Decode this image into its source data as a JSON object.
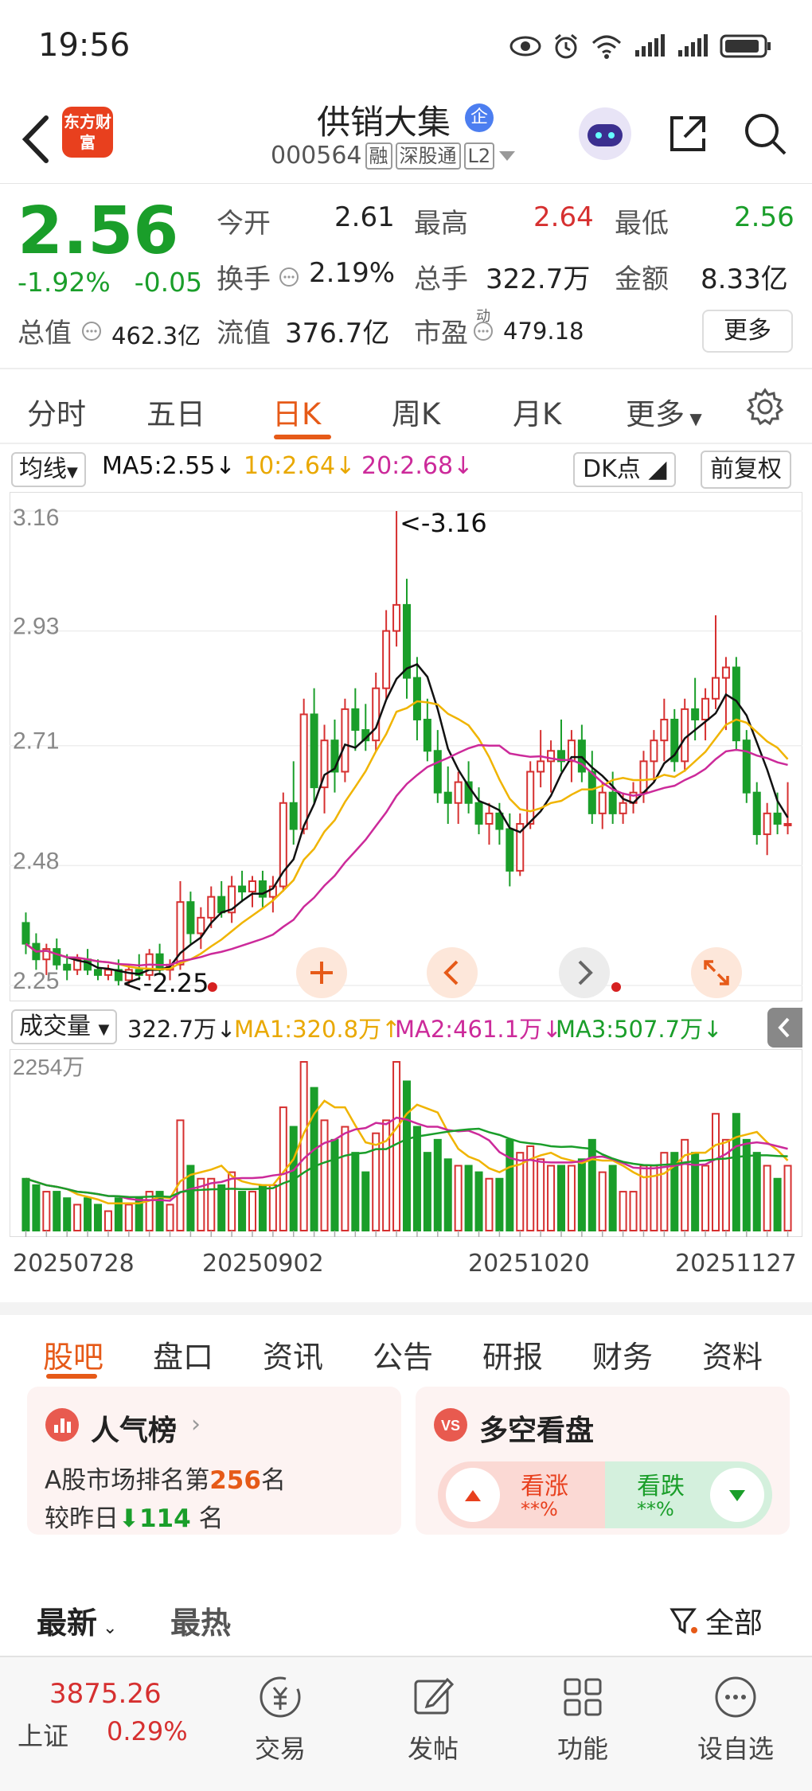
{
  "status_bar": {
    "time": "19:56"
  },
  "header": {
    "logo_text": "东方财富",
    "stock_name": "供销大集",
    "company_badge": "企",
    "stock_code": "000564",
    "tags": [
      "融",
      "深股通",
      "L2"
    ]
  },
  "quote": {
    "price": "2.56",
    "change_pct": "-1.92%",
    "change_abs": "-0.05",
    "open_label": "今开",
    "open": "2.61",
    "high_label": "最高",
    "high": "2.64",
    "low_label": "最低",
    "low": "2.56",
    "turnover_label": "换手",
    "turnover": "2.19%",
    "volume_label": "总手",
    "volume": "322.7万",
    "amount_label": "金额",
    "amount": "8.33亿",
    "mktcap_label": "总值",
    "mktcap": "462.3亿",
    "float_label": "流值",
    "float_cap": "376.7亿",
    "pe_label": "市盈",
    "pe_sup": "动",
    "pe": "479.18",
    "more_label": "更多"
  },
  "period_tabs": [
    "分时",
    "五日",
    "日K",
    "周K",
    "月K",
    "更多"
  ],
  "active_period": "日K",
  "ma_legend": {
    "selector": "均线",
    "ma5": "MA5:2.55↓",
    "ma10": "10:2.64↓",
    "ma20": "20:2.68↓",
    "dk": "DK点",
    "adjust": "前复权"
  },
  "volume_legend": {
    "selector": "成交量",
    "vol": "322.7万↓",
    "ma1": "MA1:320.8万↑",
    "ma2": "MA2:461.1万↓",
    "ma3": "MA3:507.7万↓",
    "vol_max_label": "2254万"
  },
  "colors": {
    "up": "#d63030",
    "down": "#1a9e2a",
    "ma5": "#111111",
    "ma10": "#f0b400",
    "ma20": "#cc2a9a",
    "accent": "#e65a18"
  },
  "chart_data": {
    "type": "candlestick",
    "title": "",
    "y_ticks": [
      "3.16",
      "2.93",
      "2.71",
      "2.48",
      "2.25"
    ],
    "ylim": [
      2.25,
      3.16
    ],
    "x_ticks": [
      "20250728",
      "20250902",
      "20251020",
      "20251127"
    ],
    "annotations": {
      "high": "<-3.16",
      "low": "<-2.25"
    },
    "ohlc_note": "approximate daily bars read from chart",
    "bars": [
      [
        2.37,
        2.39,
        2.31,
        2.33
      ],
      [
        2.33,
        2.35,
        2.28,
        2.3
      ],
      [
        2.3,
        2.33,
        2.27,
        2.32
      ],
      [
        2.32,
        2.34,
        2.28,
        2.29
      ],
      [
        2.29,
        2.31,
        2.26,
        2.28
      ],
      [
        2.28,
        2.31,
        2.27,
        2.3
      ],
      [
        2.3,
        2.32,
        2.27,
        2.28
      ],
      [
        2.28,
        2.3,
        2.26,
        2.27
      ],
      [
        2.27,
        2.29,
        2.26,
        2.28
      ],
      [
        2.28,
        2.3,
        2.25,
        2.26
      ],
      [
        2.26,
        2.29,
        2.25,
        2.28
      ],
      [
        2.28,
        2.31,
        2.26,
        2.27
      ],
      [
        2.27,
        2.32,
        2.26,
        2.31
      ],
      [
        2.31,
        2.33,
        2.27,
        2.28
      ],
      [
        2.28,
        2.3,
        2.26,
        2.29
      ],
      [
        2.29,
        2.45,
        2.28,
        2.41
      ],
      [
        2.41,
        2.43,
        2.33,
        2.35
      ],
      [
        2.35,
        2.4,
        2.32,
        2.38
      ],
      [
        2.38,
        2.44,
        2.36,
        2.42
      ],
      [
        2.42,
        2.45,
        2.38,
        2.39
      ],
      [
        2.39,
        2.46,
        2.37,
        2.44
      ],
      [
        2.44,
        2.47,
        2.41,
        2.43
      ],
      [
        2.43,
        2.46,
        2.4,
        2.45
      ],
      [
        2.45,
        2.47,
        2.4,
        2.42
      ],
      [
        2.42,
        2.46,
        2.39,
        2.44
      ],
      [
        2.44,
        2.62,
        2.43,
        2.6
      ],
      [
        2.6,
        2.68,
        2.52,
        2.55
      ],
      [
        2.55,
        2.8,
        2.54,
        2.77
      ],
      [
        2.77,
        2.82,
        2.6,
        2.63
      ],
      [
        2.63,
        2.75,
        2.58,
        2.72
      ],
      [
        2.72,
        2.76,
        2.62,
        2.66
      ],
      [
        2.66,
        2.8,
        2.64,
        2.78
      ],
      [
        2.78,
        2.82,
        2.7,
        2.74
      ],
      [
        2.74,
        2.79,
        2.7,
        2.72
      ],
      [
        2.72,
        2.85,
        2.7,
        2.82
      ],
      [
        2.82,
        2.97,
        2.8,
        2.93
      ],
      [
        2.93,
        3.16,
        2.9,
        2.98
      ],
      [
        2.98,
        3.03,
        2.8,
        2.84
      ],
      [
        2.84,
        2.88,
        2.72,
        2.76
      ],
      [
        2.76,
        2.8,
        2.68,
        2.7
      ],
      [
        2.7,
        2.74,
        2.6,
        2.62
      ],
      [
        2.62,
        2.67,
        2.56,
        2.6
      ],
      [
        2.6,
        2.66,
        2.56,
        2.64
      ],
      [
        2.64,
        2.68,
        2.58,
        2.6
      ],
      [
        2.6,
        2.63,
        2.54,
        2.56
      ],
      [
        2.56,
        2.6,
        2.52,
        2.58
      ],
      [
        2.58,
        2.6,
        2.52,
        2.55
      ],
      [
        2.55,
        2.58,
        2.44,
        2.47
      ],
      [
        2.47,
        2.58,
        2.46,
        2.56
      ],
      [
        2.56,
        2.68,
        2.55,
        2.66
      ],
      [
        2.66,
        2.74,
        2.63,
        2.68
      ],
      [
        2.68,
        2.72,
        2.62,
        2.7
      ],
      [
        2.7,
        2.76,
        2.66,
        2.68
      ],
      [
        2.68,
        2.74,
        2.64,
        2.72
      ],
      [
        2.72,
        2.75,
        2.64,
        2.66
      ],
      [
        2.66,
        2.7,
        2.56,
        2.58
      ],
      [
        2.58,
        2.64,
        2.55,
        2.62
      ],
      [
        2.62,
        2.66,
        2.56,
        2.58
      ],
      [
        2.58,
        2.62,
        2.56,
        2.6
      ],
      [
        2.6,
        2.64,
        2.58,
        2.62
      ],
      [
        2.62,
        2.7,
        2.6,
        2.68
      ],
      [
        2.68,
        2.74,
        2.64,
        2.72
      ],
      [
        2.72,
        2.8,
        2.68,
        2.76
      ],
      [
        2.76,
        2.78,
        2.66,
        2.68
      ],
      [
        2.68,
        2.8,
        2.66,
        2.78
      ],
      [
        2.78,
        2.84,
        2.72,
        2.76
      ],
      [
        2.76,
        2.82,
        2.72,
        2.8
      ],
      [
        2.8,
        2.96,
        2.78,
        2.84
      ],
      [
        2.84,
        2.88,
        2.74,
        2.86
      ],
      [
        2.86,
        2.88,
        2.7,
        2.72
      ],
      [
        2.72,
        2.74,
        2.6,
        2.62
      ],
      [
        2.62,
        2.64,
        2.52,
        2.54
      ],
      [
        2.54,
        2.6,
        2.5,
        2.58
      ],
      [
        2.58,
        2.62,
        2.54,
        2.56
      ],
      [
        2.56,
        2.64,
        2.54,
        2.56
      ]
    ]
  },
  "content_tabs": [
    "股吧",
    "盘口",
    "资讯",
    "公告",
    "研报",
    "财务",
    "资料"
  ],
  "active_content_tab": "股吧",
  "popularity_card": {
    "title": "人气榜",
    "rank_prefix": "A股市场排名第",
    "rank": "256",
    "rank_suffix": "名",
    "change_prefix": "较昨日",
    "change": "114",
    "change_suffix": "名"
  },
  "sentiment_card": {
    "title": "多空看盘",
    "bull_label": "看涨",
    "bull_value": "**%",
    "bear_label": "看跌",
    "bear_value": "**%"
  },
  "news_tabs": {
    "latest": "最新",
    "hot": "最热",
    "filter": "全部"
  },
  "bottom_nav": {
    "index_value": "3875.26",
    "index_name": "上证",
    "index_change": "0.29%",
    "items": [
      "交易",
      "发帖",
      "功能",
      "设自选"
    ]
  }
}
